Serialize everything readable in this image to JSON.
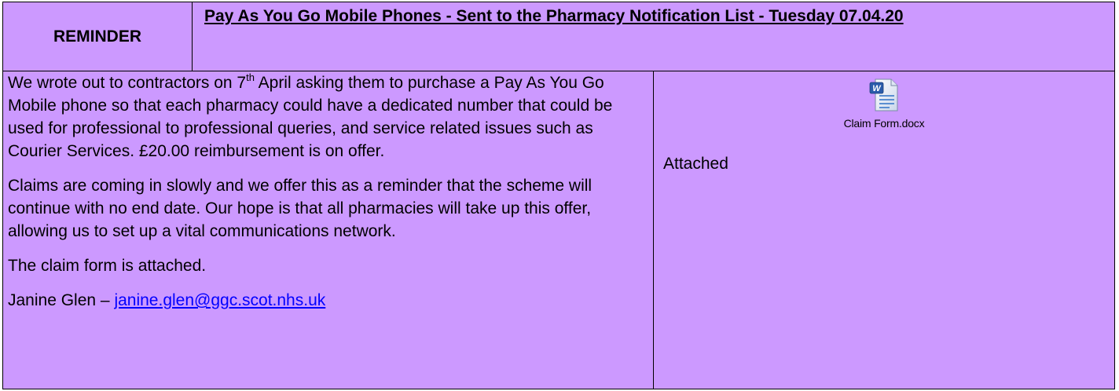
{
  "header": {
    "label": "REMINDER",
    "title": "Pay As You Go Mobile Phones - Sent to the Pharmacy Notification List - Tuesday 07.04.20"
  },
  "body": {
    "p1_before_date": "We wrote out to contractors on 7",
    "p1_superscript": "th",
    "p1_after_date": " April asking them to purchase a Pay As You Go Mobile phone so that each pharmacy could have a dedicated number that could be used for professional to professional queries, and service related issues such as Courier Services. £20.00 reimbursement is on offer.",
    "p2": "Claims are coming in slowly and we offer this as a reminder that the scheme will continue with no end date.  Our hope is that all pharmacies will take up this offer, allowing us to set up a vital communications network.",
    "p3": "The claim form is attached.",
    "contact_name": "Janine Glen – ",
    "contact_email": "janine.glen@ggc.scot.nhs.uk"
  },
  "attachment": {
    "icon": "word-document-icon",
    "filename": "Claim Form.docx",
    "status": "Attached"
  },
  "colors": {
    "background": "#cc99ff",
    "link": "#0000ff",
    "border": "#000000"
  }
}
